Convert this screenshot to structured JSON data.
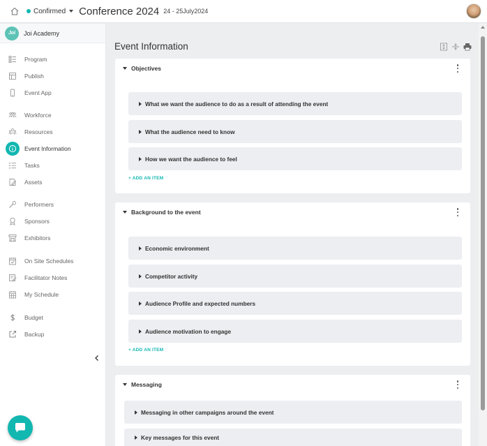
{
  "header": {
    "status_label": "Confirmed",
    "status_color": "#12b7b0",
    "event_title": "Conference 2024",
    "event_dates": "24 - 25July2024",
    "icons": [
      "home-icon",
      "avatar"
    ]
  },
  "sidebar": {
    "org_logo_text": "Joi",
    "org_name": "Joi Academy",
    "items": [
      {
        "label": "Program",
        "icon": "program-icon"
      },
      {
        "label": "Publish",
        "icon": "publish-icon"
      },
      {
        "label": "Event App",
        "icon": "phone-icon"
      },
      {
        "label": "Workforce",
        "icon": "workforce-icon"
      },
      {
        "label": "Resources",
        "icon": "resources-icon"
      },
      {
        "label": "Event Information",
        "icon": "info-icon",
        "active": true
      },
      {
        "label": "Tasks",
        "icon": "tasks-icon"
      },
      {
        "label": "Assets",
        "icon": "assets-icon"
      },
      {
        "label": "Performers",
        "icon": "performers-icon"
      },
      {
        "label": "Sponsors",
        "icon": "sponsors-icon"
      },
      {
        "label": "Exhibitors",
        "icon": "exhibitors-icon"
      },
      {
        "label": "On Site Schedules",
        "icon": "schedule-check-icon"
      },
      {
        "label": "Facilitator Notes",
        "icon": "notes-icon"
      },
      {
        "label": "My Schedule",
        "icon": "calendar-icon"
      },
      {
        "label": "Budget",
        "icon": "dollar-icon"
      },
      {
        "label": "Backup",
        "icon": "backup-icon"
      }
    ]
  },
  "main": {
    "title": "Event Information",
    "toolbar_icons": [
      "expand-icon",
      "collapse-all-icon",
      "print-icon"
    ],
    "sections": [
      {
        "title": "Objectives",
        "items": [
          "What we want the audience to do as a result of attending the event",
          "What the audience need to know",
          "How we want the audience to feel"
        ],
        "add_label": "+ ADD AN ITEM"
      },
      {
        "title": "Background to the event",
        "items": [
          "Economic environment",
          "Competitor activity",
          "Audience Profile and expected numbers",
          "Audience motivation to engage"
        ],
        "add_label": "+ ADD AN ITEM"
      },
      {
        "title": "Messaging",
        "items": [
          "Messaging in other campaigns around the event",
          "Key messages for this event"
        ]
      }
    ]
  },
  "colors": {
    "accent": "#12b7b0",
    "background": "#eceef0",
    "item_background": "#eceef1"
  }
}
